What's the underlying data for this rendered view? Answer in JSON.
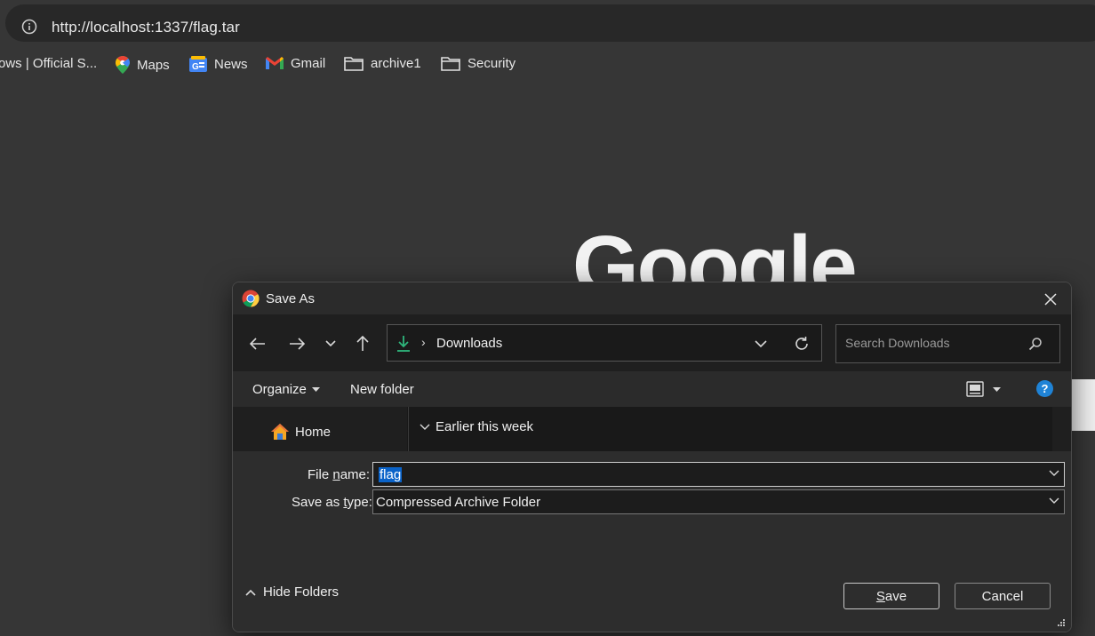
{
  "browser": {
    "url": "http://localhost:1337/flag.tar",
    "bookmarks": [
      {
        "label": "ows | Official S...",
        "icon": "windows-icon"
      },
      {
        "label": "Maps",
        "icon": "maps-pin-icon"
      },
      {
        "label": "News",
        "icon": "google-news-icon"
      },
      {
        "label": "Gmail",
        "icon": "gmail-icon"
      },
      {
        "label": "archive1",
        "icon": "folder-icon"
      },
      {
        "label": "Security",
        "icon": "folder-icon"
      }
    ],
    "page_logo": "Google"
  },
  "dialog": {
    "title": "Save As",
    "path": {
      "location": "Downloads"
    },
    "search": {
      "placeholder": "Search Downloads"
    },
    "toolbar": {
      "organize_label": "Organize",
      "new_folder_label": "New folder"
    },
    "nav_pane": {
      "home_label": "Home"
    },
    "file_list": {
      "group_label": "Earlier this week"
    },
    "form": {
      "file_name_label_pre": "File ",
      "file_name_label_access": "n",
      "file_name_label_post": "ame:",
      "file_name_value": "flag",
      "save_type_label_pre": "Save as ",
      "save_type_label_access": "t",
      "save_type_label_post": "ype:",
      "save_type_value": "Compressed Archive Folder"
    },
    "hide_folders_label": "Hide Folders",
    "save_access": "S",
    "save_rest": "ave",
    "cancel_label": "Cancel"
  },
  "colors": {
    "accent": "#1f83d6",
    "selection": "#0a63c9",
    "download_green": "#2fb67c"
  }
}
